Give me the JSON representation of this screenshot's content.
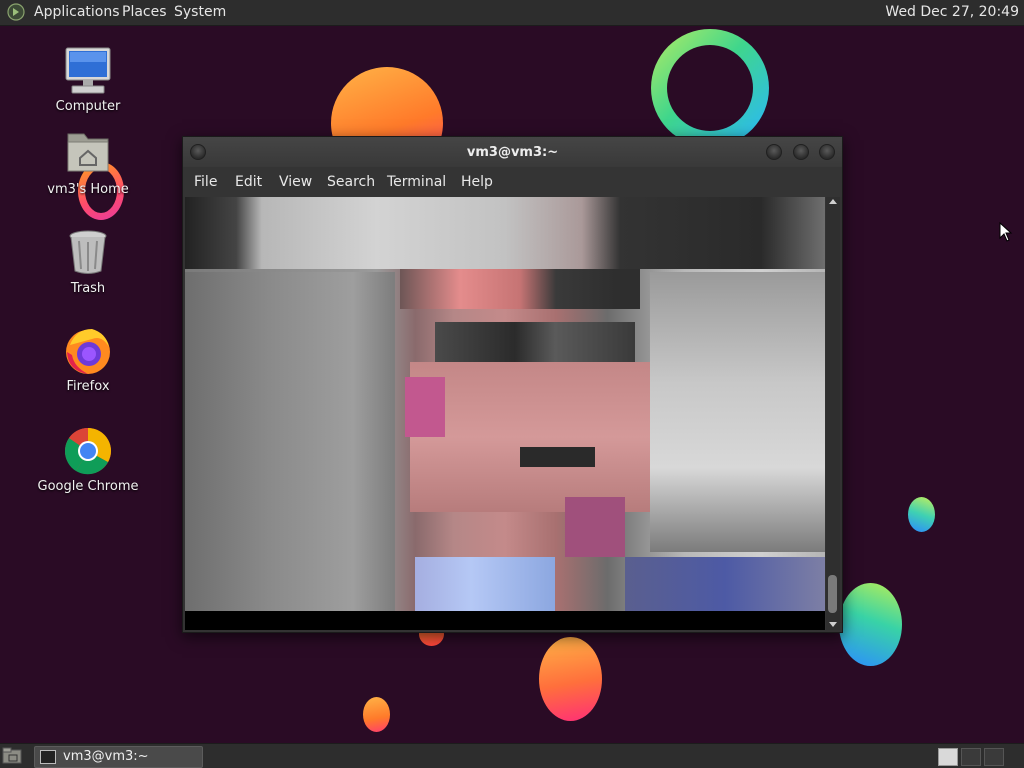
{
  "top_panel": {
    "menus": [
      "Applications",
      "Places",
      "System"
    ],
    "clock": "Wed Dec 27, 20:49"
  },
  "desktop_icons": [
    {
      "label": "Computer",
      "icon": "computer-icon"
    },
    {
      "label": "vm3's Home",
      "icon": "home-folder-icon"
    },
    {
      "label": "Trash",
      "icon": "trash-icon"
    },
    {
      "label": "Firefox",
      "icon": "firefox-icon"
    },
    {
      "label": "Google Chrome",
      "icon": "chrome-icon"
    }
  ],
  "terminal": {
    "title": "vm3@vm3:~",
    "menu": [
      "File",
      "Edit",
      "View",
      "Search",
      "Terminal",
      "Help"
    ]
  },
  "taskbar": {
    "items": [
      {
        "label": "vm3@vm3:~",
        "icon": "terminal-icon"
      }
    ]
  },
  "colors": {
    "wallpaper": "#2a0b25",
    "panel": "#2d2d2d"
  }
}
